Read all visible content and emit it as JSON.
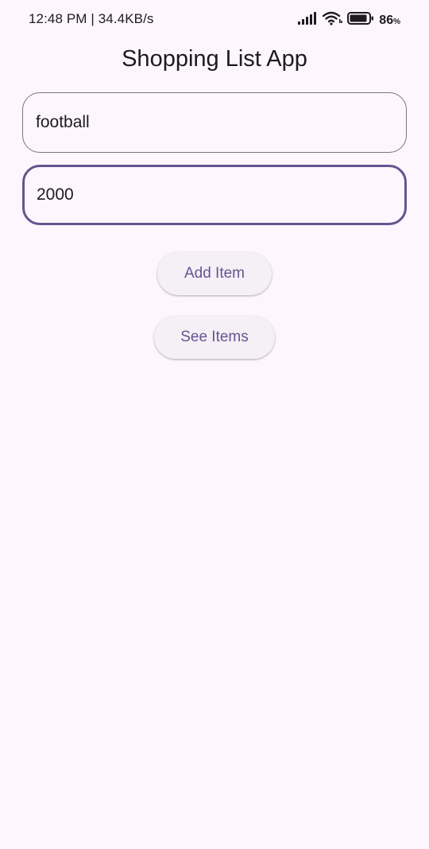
{
  "status_bar": {
    "time_speed": "12:48 PM | 34.4KB/s",
    "battery_level": "86",
    "battery_unit": "%",
    "icons": [
      "signal-icon",
      "wifi-icon",
      "battery-icon"
    ]
  },
  "app_bar": {
    "title": "Shopping List App"
  },
  "form": {
    "item_name_value": "football",
    "item_price_value": "2000"
  },
  "buttons": {
    "add_label": "Add Item",
    "see_label": "See Items"
  },
  "colors": {
    "background": "#fdf7fd",
    "primary": "#65558f",
    "outline": "#79747e",
    "button_surface": "#f5eff6"
  }
}
